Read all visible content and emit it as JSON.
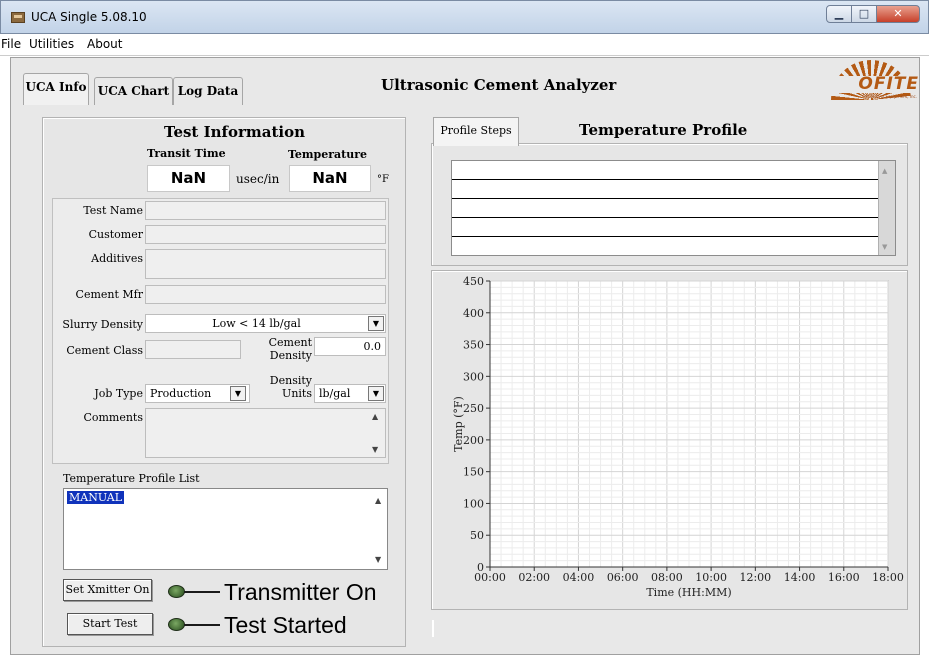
{
  "window": {
    "title": "UCA Single 5.08.10"
  },
  "menu": {
    "items": [
      "File",
      "Utilities",
      "About"
    ]
  },
  "tabs": [
    "UCA Info",
    "UCA Chart",
    "Log Data"
  ],
  "app_heading": "Ultrasonic Cement Analyzer",
  "logo": {
    "text": "OFITE",
    "tagline": "OFI Testing Equipment, Inc."
  },
  "test_info": {
    "title": "Test Information",
    "transit_time_label": "Transit Time",
    "temperature_label": "Temperature",
    "transit_time_value": "NaN",
    "transit_time_unit": "usec/in",
    "temperature_value": "NaN",
    "temperature_unit": "°F"
  },
  "form": {
    "test_name_label": "Test Name",
    "test_name_value": "",
    "customer_label": "Customer",
    "customer_value": "",
    "additives_label": "Additives",
    "additives_value": "",
    "cement_mfr_label": "Cement Mfr",
    "cement_mfr_value": "",
    "slurry_density_label": "Slurry Density",
    "slurry_density_value": "Low < 14 lb/gal",
    "cement_class_label": "Cement Class",
    "cement_class_value": "",
    "cement_density_label_1": "Cement",
    "cement_density_label_2": "Density",
    "cement_density_value": "0.0",
    "job_type_label": "Job Type",
    "job_type_value": "Production",
    "density_units_label_1": "Density",
    "density_units_label_2": "Units",
    "density_units_value": "lb/gal",
    "comments_label": "Comments",
    "comments_value": ""
  },
  "temp_profile_list": {
    "label": "Temperature Profile List",
    "items": [
      "MANUAL"
    ]
  },
  "controls": {
    "xmitter_button": "Set Xmitter On",
    "start_button": "Start Test",
    "transmitter_indicator": "Transmitter On",
    "test_started_indicator": "Test Started"
  },
  "right_panel": {
    "tab_label": "Profile Steps",
    "title": "Temperature Profile"
  },
  "chart_data": {
    "type": "line",
    "xlabel": "Time (HH:MM)",
    "ylabel": "Temp (°F)",
    "x_ticks": [
      "00:00",
      "02:00",
      "04:00",
      "06:00",
      "08:00",
      "10:00",
      "12:00",
      "14:00",
      "16:00",
      "18:00"
    ],
    "y_ticks": [
      "0",
      "50",
      "100",
      "150",
      "200",
      "250",
      "300",
      "350",
      "400",
      "450"
    ],
    "xlim": [
      0,
      18
    ],
    "ylim": [
      0,
      450
    ],
    "grid": true,
    "series": []
  },
  "colors": {
    "panel_bg": "#e6e6e6",
    "selection": "#1033bb",
    "logo_orange": "#b45a14",
    "led_green": "#4a7a3a"
  }
}
